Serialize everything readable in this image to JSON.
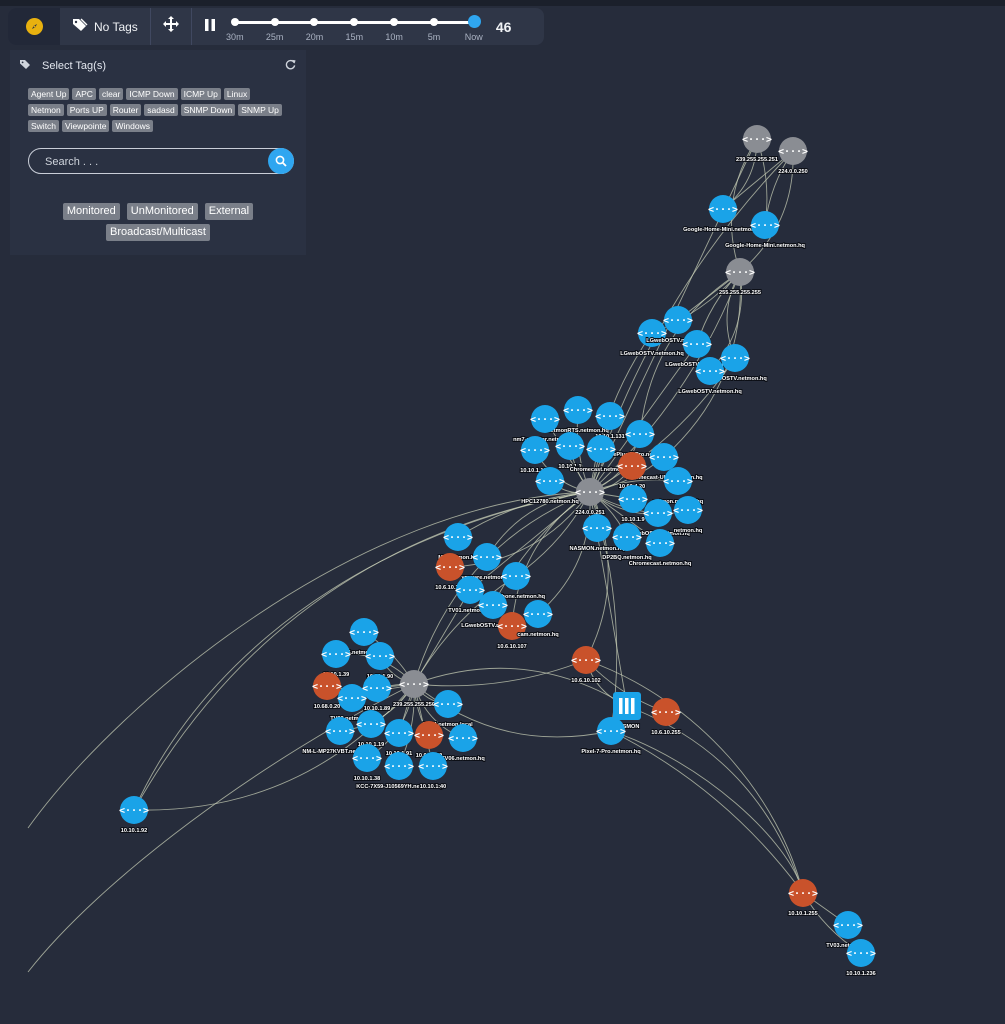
{
  "toolbar": {
    "no_tags_label": "No Tags",
    "count": "46",
    "timeline": [
      "30m",
      "25m",
      "20m",
      "15m",
      "10m",
      "5m",
      "Now"
    ],
    "accent_color": "#2fa6f0",
    "compass_color": "#e8b10f"
  },
  "tag_panel": {
    "title": "Select Tag(s)",
    "tags": [
      "Agent Up",
      "APC",
      "clear",
      "ICMP Down",
      "ICMP Up",
      "Linux",
      "Netmon",
      "Ports UP",
      "Router",
      "sadasd",
      "SNMP Down",
      "SNMP Up",
      "Switch",
      "Viewpointe",
      "Windows"
    ],
    "search_placeholder": "Search . . .",
    "filters_row1": [
      "Monitored",
      "UnMonitored",
      "External"
    ],
    "filters_row2": [
      "Broadcast/Multicast"
    ]
  },
  "legend_colors": {
    "monitored": "#1aa3e8",
    "down": "#c9522b",
    "hub": "#8a8d93"
  },
  "graph": {
    "nodes": [
      {
        "id": "n239251",
        "label": "239.255.255.251",
        "type": "hub"
      },
      {
        "id": "n224250",
        "label": "224.0.0.250",
        "type": "hub"
      },
      {
        "id": "ghm1",
        "label": "Google-Home-Mini.netmon.hq",
        "type": "device"
      },
      {
        "id": "ghm2",
        "label": "Google-Home-Mini.netmon.hq",
        "type": "device"
      },
      {
        "id": "n255",
        "label": "255.255.255.255",
        "type": "hub"
      },
      {
        "id": "lg1",
        "label": "LGwebOSTV.netmon.hq",
        "type": "device"
      },
      {
        "id": "lg2",
        "label": "LGwebOSTV.netmon.hq",
        "type": "device"
      },
      {
        "id": "lg3",
        "label": "LGwebOSTV.netmon.hq",
        "type": "device"
      },
      {
        "id": "lg4",
        "label": "LGwebOSTV.netmon.hq",
        "type": "device"
      },
      {
        "id": "lg5",
        "label": "LGwebOSTV.netmon.hq",
        "type": "device"
      },
      {
        "id": "rts",
        "label": "netmonRTS.netmon.hq",
        "type": "device"
      },
      {
        "id": "nm7",
        "label": "nm7-ramstar.netmon.hq",
        "type": "device"
      },
      {
        "id": "ip131",
        "label": "10.10.1.131",
        "type": "device"
      },
      {
        "id": "op7",
        "label": "OnePlus-7-Pro.netmon.hq",
        "type": "device"
      },
      {
        "id": "ip185",
        "label": "10.10.1.185",
        "type": "device"
      },
      {
        "id": "ipx1",
        "label": "10.10.1.1",
        "type": "device"
      },
      {
        "id": "cc1",
        "label": "Chromecast.netmon.hq",
        "type": "device"
      },
      {
        "id": "ccu",
        "label": "Chromecast-Ultra.netmon.hq",
        "type": "device"
      },
      {
        "id": "ip6020",
        "label": "10.60.4.20",
        "type": "down"
      },
      {
        "id": "hpc",
        "label": "HPC12780.netmon.hq",
        "type": "device"
      },
      {
        "id": "n224251",
        "label": "224.0.0.251",
        "type": "hub"
      },
      {
        "id": "nmhq",
        "label": "netmon.netmon.hq",
        "type": "device"
      },
      {
        "id": "ip19",
        "label": "10.10.1.9",
        "type": "device"
      },
      {
        "id": "lg6",
        "label": "LGwebOSTV.netmon.hq",
        "type": "device"
      },
      {
        "id": "nmhq2",
        "label": "netmon.hq",
        "type": "device"
      },
      {
        "id": "nasmon",
        "label": "NASMON.netmon.hq",
        "type": "device"
      },
      {
        "id": "dp2",
        "label": "DP2BQ.netmon.hq",
        "type": "device"
      },
      {
        "id": "cc2",
        "label": "Chromecast.netmon.hq",
        "type": "device"
      },
      {
        "id": "mm",
        "label": "MM.netmon.hq",
        "type": "device"
      },
      {
        "id": "vmw",
        "label": "vmware.netmon.hq",
        "type": "device"
      },
      {
        "id": "ip108",
        "label": "10.6.10.108",
        "type": "down"
      },
      {
        "id": "rob",
        "label": "RobPhone.netmon.hq",
        "type": "device"
      },
      {
        "id": "tv01",
        "label": "TV01.netmon.hq",
        "type": "device"
      },
      {
        "id": "lg7",
        "label": "LGwebOSTV.netmon.hq",
        "type": "device"
      },
      {
        "id": "ip107",
        "label": "10.6.10.107",
        "type": "down"
      },
      {
        "id": "cam",
        "label": "cam.netmon.hq",
        "type": "device"
      },
      {
        "id": "n5",
        "label": "5.netmon.hq",
        "type": "device"
      },
      {
        "id": "ip139",
        "label": "10.10.1.39",
        "type": "device"
      },
      {
        "id": "ip190",
        "label": "10.10.1.90",
        "type": "device"
      },
      {
        "id": "n239250",
        "label": "239.255.255.250",
        "type": "hub"
      },
      {
        "id": "ip6820",
        "label": "10.68.0.20",
        "type": "down"
      },
      {
        "id": "ip189",
        "label": "10.10.1.89",
        "type": "device"
      },
      {
        "id": "tv02",
        "label": "TV02.netmon.hq",
        "type": "device"
      },
      {
        "id": "tv04",
        "label": "TV04.netmon.local",
        "type": "device"
      },
      {
        "id": "ip102",
        "label": "10.6.10.102",
        "type": "down"
      },
      {
        "id": "nasmonb",
        "label": "NASMON",
        "type": "server"
      },
      {
        "id": "ip1255b",
        "label": "10.6.10.255",
        "type": "down"
      },
      {
        "id": "pixel",
        "label": "Pixel-7-Pro.netmon.hq",
        "type": "device"
      },
      {
        "id": "nml",
        "label": "NM-L-MP27KVBT.netmon.hq",
        "type": "device"
      },
      {
        "id": "ip119",
        "label": "10.10.1.19",
        "type": "device"
      },
      {
        "id": "ip191",
        "label": "10.10.1.91",
        "type": "device"
      },
      {
        "id": "ip0249",
        "label": "10.0.0.249",
        "type": "down"
      },
      {
        "id": "tv06",
        "label": "TV06.netmon.hq",
        "type": "device"
      },
      {
        "id": "ip138",
        "label": "10.10.1.38",
        "type": "device"
      },
      {
        "id": "kcc",
        "label": "KCC-7X59-J10569YH.netmon.hq",
        "type": "device"
      },
      {
        "id": "ip140",
        "label": "10.10.1.40",
        "type": "device"
      },
      {
        "id": "ip192",
        "label": "10.10.1.92",
        "type": "device"
      },
      {
        "id": "ip1255",
        "label": "10.10.1.255",
        "type": "down"
      },
      {
        "id": "tv03",
        "label": "TV03.netmon.hq",
        "type": "device"
      },
      {
        "id": "ip1236",
        "label": "10.10.1.236",
        "type": "device"
      }
    ],
    "edges": [
      [
        "n239251",
        "ghm1"
      ],
      [
        "n239251",
        "ghm2"
      ],
      [
        "n224250",
        "ghm1"
      ],
      [
        "n224250",
        "ghm2"
      ],
      [
        "n239251",
        "n255"
      ],
      [
        "n224250",
        "n255"
      ],
      [
        "n255",
        "lg1"
      ],
      [
        "n255",
        "lg2"
      ],
      [
        "n255",
        "lg3"
      ],
      [
        "n255",
        "lg4"
      ],
      [
        "n255",
        "lg5"
      ],
      [
        "n255",
        "n224251"
      ],
      [
        "n239251",
        "n224251"
      ],
      [
        "n224250",
        "n224251"
      ],
      [
        "n255",
        "op7"
      ],
      [
        "n255",
        "ccu"
      ],
      [
        "n224251",
        "rts"
      ],
      [
        "n224251",
        "nm7"
      ],
      [
        "n224251",
        "ip131"
      ],
      [
        "n224251",
        "op7"
      ],
      [
        "n224251",
        "ip185"
      ],
      [
        "n224251",
        "ipx1"
      ],
      [
        "n224251",
        "cc1"
      ],
      [
        "n224251",
        "ccu"
      ],
      [
        "n224251",
        "ip6020"
      ],
      [
        "n224251",
        "hpc"
      ],
      [
        "n224251",
        "nmhq"
      ],
      [
        "n224251",
        "ip19"
      ],
      [
        "n224251",
        "lg6"
      ],
      [
        "n224251",
        "nmhq2"
      ],
      [
        "n224251",
        "nasmon"
      ],
      [
        "n224251",
        "dp2"
      ],
      [
        "n224251",
        "cc2"
      ],
      [
        "n224251",
        "mm"
      ],
      [
        "n224251",
        "vmw"
      ],
      [
        "n224251",
        "ip108"
      ],
      [
        "n224251",
        "rob"
      ],
      [
        "n224251",
        "tv01"
      ],
      [
        "n224251",
        "lg7"
      ],
      [
        "n224251",
        "ip107"
      ],
      [
        "n224251",
        "cam"
      ],
      [
        "n224251",
        "lg1"
      ],
      [
        "n224251",
        "lg3"
      ],
      [
        "n224251",
        "lg4"
      ],
      [
        "n224251",
        "n239250"
      ],
      [
        "n224251",
        "ip102"
      ],
      [
        "n224251",
        "pixel"
      ],
      [
        "n224251",
        "nasmonb"
      ],
      [
        "n239250",
        "n5"
      ],
      [
        "n239250",
        "ip139"
      ],
      [
        "n239250",
        "ip190"
      ],
      [
        "n239250",
        "ip6820"
      ],
      [
        "n239250",
        "ip189"
      ],
      [
        "n239250",
        "tv02"
      ],
      [
        "n239250",
        "tv04"
      ],
      [
        "n239250",
        "nml"
      ],
      [
        "n239250",
        "ip119"
      ],
      [
        "n239250",
        "ip191"
      ],
      [
        "n239250",
        "ip0249"
      ],
      [
        "n239250",
        "tv06"
      ],
      [
        "n239250",
        "ip138"
      ],
      [
        "n239250",
        "kcc"
      ],
      [
        "n239250",
        "ip140"
      ],
      [
        "n239250",
        "ip102"
      ],
      [
        "n239250",
        "pixel"
      ],
      [
        "n239250",
        "nasmonb"
      ],
      [
        "n239250",
        "rob"
      ],
      [
        "n239250",
        "tv01"
      ],
      [
        "ip102",
        "ip1255b"
      ],
      [
        "ip102",
        "nasmonb"
      ],
      [
        "nasmonb",
        "ip1255"
      ],
      [
        "pixel",
        "ip1255"
      ],
      [
        "ip1255",
        "tv03"
      ],
      [
        "ip1255",
        "ip1236"
      ],
      [
        "n224251",
        "ip192"
      ],
      [
        "n239250",
        "ip192"
      ]
    ]
  }
}
